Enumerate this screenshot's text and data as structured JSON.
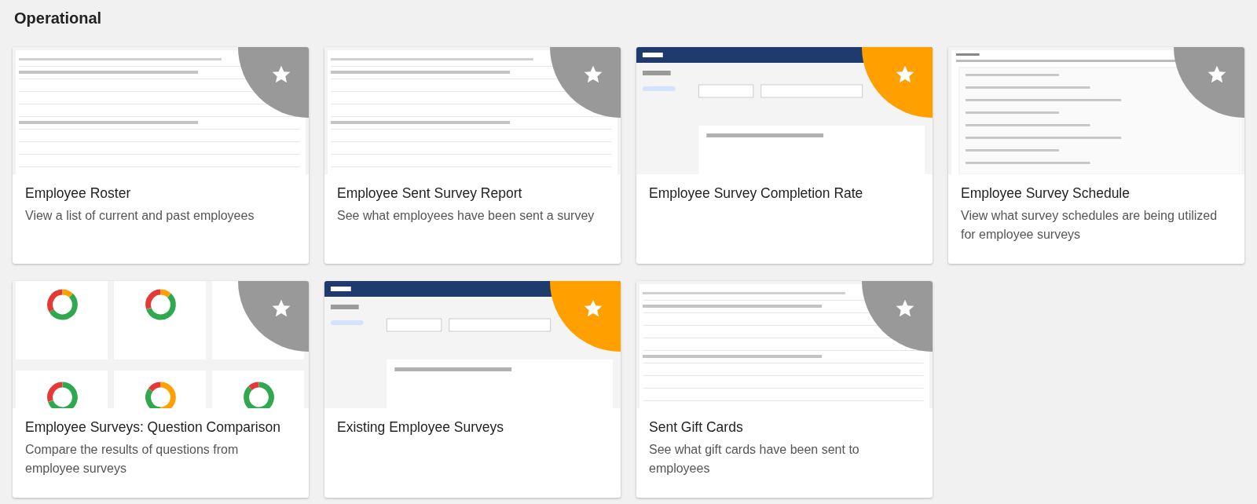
{
  "section": {
    "title": "Operational"
  },
  "cards": [
    {
      "title": "Employee Roster",
      "description": "View a list of current and past employees",
      "favorite": false
    },
    {
      "title": "Employee Sent Survey Report",
      "description": "See what employees have been sent a survey",
      "favorite": false
    },
    {
      "title": "Employee Survey Completion Rate",
      "favorite": true
    },
    {
      "title": "Employee Survey Schedule",
      "description": "View what survey schedules are being utilized for employee surveys",
      "favorite": false
    },
    {
      "title": "Employee Surveys: Question Comparison",
      "description": "Compare the results of questions from employee surveys",
      "favorite": false
    },
    {
      "title": "Existing Employee Surveys",
      "favorite": true
    },
    {
      "title": "Sent Gift Cards",
      "description": "See what gift cards have been sent to employees",
      "favorite": false
    }
  ]
}
